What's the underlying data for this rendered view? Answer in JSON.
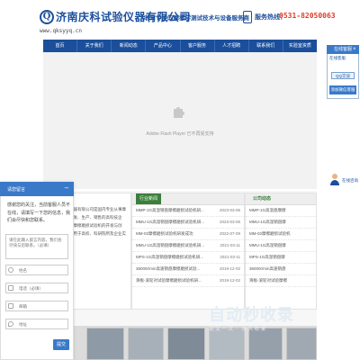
{
  "header": {
    "logo_letter": "Q",
    "company_name": "济南庆科试验仪器有限公司",
    "slogan": "非常专业的摩擦学测试技术与设备服务商",
    "domain": "www.qksyyq.cn",
    "hotline_label": "服务热线：",
    "hotline_number": "0531-82050063"
  },
  "nav": {
    "items": [
      "首页",
      "关于我们",
      "新闻动态",
      "产品中心",
      "客户服务",
      "人才招聘",
      "联系我们",
      "实验室资质"
    ]
  },
  "banner": {
    "flash_message": "Adobe Flash Player 已不再受支持"
  },
  "float_widget": {
    "title": "在线客服",
    "online_title": "在线客服",
    "qq_label": "QQ交谈",
    "wechat_label": "添加微信客服",
    "collapse_icon": "close-icon"
  },
  "consult": {
    "label": "在线咨询"
  },
  "sections": {
    "about_text": "济南庆科试验仪器有限公司是国内专业从事摩擦学测试仪器研发、生产、销售的高科技企业。我们致力于摩擦磨损试验机的开发与创新，产品广泛应用于高校、科研院所及企业实验室。",
    "news_tab": "行业新闻",
    "news": [
      {
        "title": "MMP-1G高温销盘摩擦磨损试验机研...",
        "date": "2023-03-06"
      },
      {
        "title": "MMU-1G高温销盘摩擦磨损试验机研...",
        "date": "2023-03-06"
      },
      {
        "title": "MM-02摩擦磨损试验机研发成功",
        "date": "2022-07-09"
      },
      {
        "title": "MMU-1G高温销盘摩擦磨损试验机研...",
        "date": "2021-03-11"
      },
      {
        "title": "MPS-1G高温销盘摩擦磨损试验机研...",
        "date": "2021-03-11"
      },
      {
        "title": "36000r/min高速销盘摩擦磨损试验...",
        "date": "2019-12-02"
      },
      {
        "title": "滑板-滚轮对试验摩擦磨损试验机研...",
        "date": "2019-12-02"
      }
    ],
    "company_tab": "公司动态",
    "company": [
      "MMP-1G高温盘摩擦",
      "MMU-1G高温销盘摩",
      "MM-02摩擦磨损试验机",
      "MMU-1G高温销盘摩",
      "MPS-1G高温销盘摩",
      "36000r/min高速销盘",
      "滑板-滚轮对试验摩擦"
    ]
  },
  "watermark": {
    "logo_text": "自动秒收录",
    "subtitle": "提交一次 · 永久收录"
  },
  "chat": {
    "title": "请您留言",
    "collapse_icon": "minus-icon",
    "message": "感谢您的关注，当前客服人员不在线，请填写一下您的信息，我们会尽快和您联系。",
    "textarea_placeholder": "请在此输入留言内容，我们会尽快与您联系。（必填）",
    "fields": [
      {
        "placeholder": "姓名",
        "icon": "user-icon"
      },
      {
        "placeholder": "电话（必填）",
        "icon": "phone-icon"
      },
      {
        "placeholder": "邮箱",
        "icon": "mail-icon"
      },
      {
        "placeholder": "地址",
        "icon": "location-icon"
      }
    ],
    "submit_label": "提交"
  },
  "colors": {
    "brand_blue": "#1b4f9c",
    "nav_bg": "#1b4f9c",
    "hotline_red": "#e23a2a",
    "accent_blue": "#3a79c8",
    "section_green": "#3b7f3b"
  }
}
